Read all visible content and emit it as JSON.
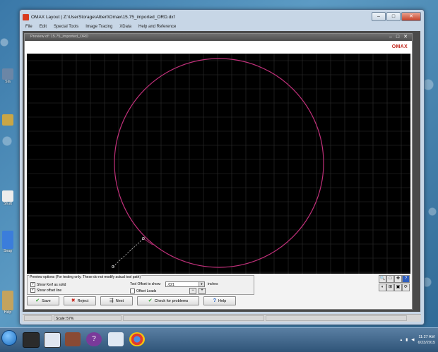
{
  "desktop": {
    "icons": [
      {
        "label": "Sta",
        "color": "#6b86a6"
      },
      {
        "label": "",
        "color": "#c9a646"
      },
      {
        "label": "Shutt",
        "color": "#ececec"
      },
      {
        "label": "Snag",
        "color": "#3b7ddb"
      },
      {
        "label": "Help",
        "color": "#c3a35e"
      }
    ]
  },
  "window": {
    "title": "OMAX Layout | Z:\\UserStorage\\Albert\\Omax\\15.75_imported_ORD.dxf",
    "menu": [
      "File",
      "Edit",
      "Special Tools",
      "Image Tracing",
      "XData",
      "Help and Reference"
    ]
  },
  "preview": {
    "title": "Preview of: 15.75_imported_ORD",
    "logo": "OMAX",
    "colors": {
      "grid": "#2f2f2f",
      "circle": "#c0307a",
      "lead": "#cccccc"
    }
  },
  "options": {
    "legend": "Preview options (For testing only. These do not modify actual tool path)",
    "show_kerf": "Show Kerf as solid",
    "show_offset": "Show offset line",
    "offset_leads": "Offset Leads",
    "show_kerf_checked": true,
    "show_offset_checked": true,
    "offset_leads_checked": false,
    "tool_offset_label": "Tool Offset to show:",
    "tool_offset_value": ".021",
    "unit": "inches"
  },
  "buttons": {
    "save": "Save",
    "reject": "Reject",
    "next": "Next",
    "check": "Check for problems",
    "help": "Help"
  },
  "status": {
    "scale": "Scale: 57%"
  },
  "taskbar": {
    "time": "11:27 AM",
    "date": "6/23/2015"
  }
}
